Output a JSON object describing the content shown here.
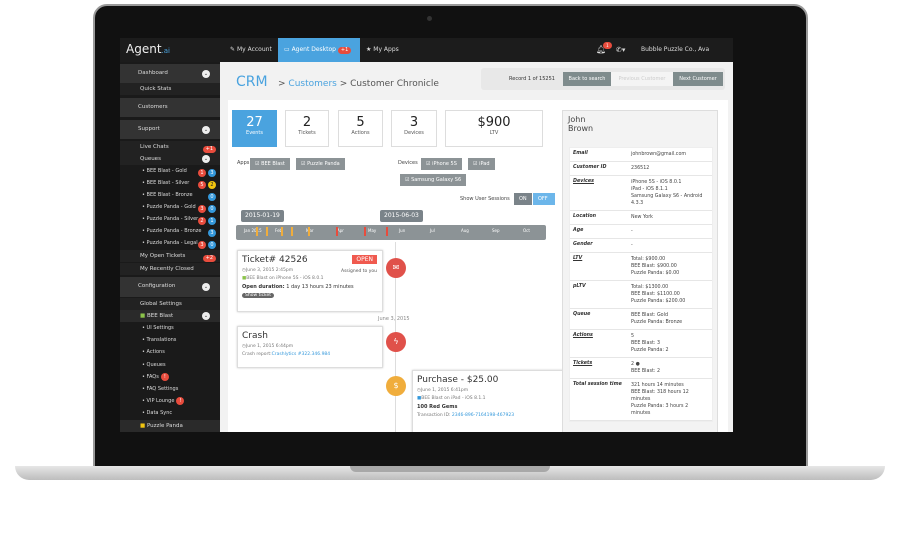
{
  "topbar": {
    "logo": "Agent",
    "logo_suffix": ".ai",
    "nav": [
      {
        "label": "My Account",
        "icon": "edit-icon"
      },
      {
        "label": "Agent Desktop",
        "icon": "monitor-icon",
        "badge": "+1"
      },
      {
        "label": "My Apps",
        "icon": "star-icon"
      }
    ],
    "notification_count": "1",
    "account": "Bubble Puzzle Co., Ava Smith"
  },
  "sidebar": {
    "items": [
      {
        "label": "Dashboard",
        "type": "section",
        "icon": "dashboard-icon"
      },
      {
        "label": "Quick Stats",
        "type": "sub"
      },
      {
        "label": "Customers",
        "type": "section",
        "icon": "users-icon"
      },
      {
        "label": "Support",
        "type": "section",
        "icon": "document-icon"
      },
      {
        "label": "Live Chats",
        "type": "sub",
        "badge": "+1"
      },
      {
        "label": "Queues",
        "type": "sub"
      }
    ],
    "queues": [
      {
        "label": "BEE Blast - Gold",
        "red": "1",
        "blue": "3"
      },
      {
        "label": "BEE Blast - Silver",
        "red": "5",
        "yellow": "2"
      },
      {
        "label": "BEE Blast - Bronze",
        "blue": "0"
      },
      {
        "label": "Puzzle Panda - Gold",
        "red": "3",
        "blue": "0"
      },
      {
        "label": "Puzzle Panda - Silver",
        "red": "2",
        "blue": "1"
      },
      {
        "label": "Puzzle Panda - Bronze",
        "blue": "3"
      },
      {
        "label": "Puzzle Panda - Legal",
        "red": "3",
        "blue": "0"
      }
    ],
    "my_open_tickets": "My Open Tickets",
    "my_open_badge": "+2",
    "recently_closed": "My Recently Closed",
    "configuration": "Configuration",
    "global_settings": "Global Settings",
    "bee_blast": "BEE Blast",
    "bee_sub": [
      "UI Settings",
      "Translations",
      "Actions",
      "Queues",
      "FAQs",
      "FAQ Settings",
      "VIP Lounge",
      "Data Sync"
    ],
    "bee_sub_alert": "!",
    "puzzle_panda": "Puzzle Panda"
  },
  "main": {
    "crm": "CRM",
    "breadcrumb_sep": ">",
    "breadcrumb_customers": "Customers",
    "breadcrumb_current": "Customer Chronicle",
    "record": "Record 1 of 15251",
    "back": "Back to search",
    "prev": "Previous Customer",
    "next": "Next Customer",
    "stats": [
      {
        "value": "27",
        "label": "Events"
      },
      {
        "value": "2",
        "label": "Tickets"
      },
      {
        "value": "5",
        "label": "Actions"
      },
      {
        "value": "3",
        "label": "Devices"
      },
      {
        "value": "$900",
        "label": "LTV"
      }
    ],
    "apps_label": "Apps",
    "apps": [
      "☑ BEE Blast",
      "☑ Puzzle Panda"
    ],
    "devices_label": "Devices",
    "devices": [
      "☑ iPhone 5S",
      "☑ iPad",
      "☑ Samsung Galaxy S6"
    ],
    "sessions_label": "Show User Sessions",
    "on": "ON",
    "off": "OFF",
    "timeline": {
      "start": "2015-01-19",
      "end": "2015-06-03",
      "months": [
        "Jan 2015",
        "Feb",
        "Mar",
        "Apr",
        "May",
        "Jun",
        "Jul",
        "Aug",
        "Sep",
        "Oct"
      ]
    },
    "ticket": {
      "title": "Ticket# 42526",
      "status": "OPEN",
      "date": "June 3, 2015 2:45pm",
      "assigned": "Assigned to you",
      "device": "BEE Blast on  iPhone 5S - iOS 8.0.1",
      "duration_label": "Open duration:",
      "duration": "1 day 13 hours 23 minutes",
      "show": "Show ticket"
    },
    "date_sep": "June 3, 2015",
    "crash": {
      "title": "Crash",
      "date": "June 1, 2015 6:44pm",
      "report_label": "Crash report:",
      "report": "Crashlytics #322.346.984"
    },
    "purchase": {
      "title": "Purchase - $25.00",
      "date": "June 1, 2015 6:41pm",
      "device": "BEE Blast on  iPad - iOS 8.1.1",
      "item": "100 Red Gems",
      "tx_label": "Transaction ID:",
      "tx": "2346-896-7164198-467923"
    }
  },
  "profile": {
    "first": "John",
    "last": "Brown",
    "rows": [
      {
        "k": "Email",
        "v": [
          "johnbrown@gmail.com"
        ]
      },
      {
        "k": "Customer ID",
        "v": [
          "236512"
        ]
      },
      {
        "k": "Devices",
        "u": true,
        "v": [
          " iPhone 5S - iOS 8.0.1",
          " iPad - iOS 8.1.1",
          " Samsung Galaxy S6 - Android 4.3.3"
        ]
      },
      {
        "k": "Location",
        "v": [
          "New York"
        ]
      },
      {
        "k": "Age",
        "v": [
          "-"
        ]
      },
      {
        "k": "Gender",
        "v": [
          "-"
        ]
      },
      {
        "k": "LTV",
        "u": true,
        "v": [
          "Total: $900.00",
          "BEE Blast: $900.00",
          "Puzzle Panda: $0.00"
        ]
      },
      {
        "k": "pLTV",
        "v": [
          "Total: $1300.00",
          "BEE Blast: $1100.00",
          "Puzzle Panda: $200.00"
        ]
      },
      {
        "k": "Queue",
        "v": [
          "BEE Blast: Gold",
          "Puzzle Panda: Bronze"
        ]
      },
      {
        "k": "Actions",
        "u": true,
        "v": [
          "5",
          "BEE Blast: 3",
          "Puzzle Panda: 2"
        ]
      },
      {
        "k": "Tickets",
        "u": true,
        "v": [
          "2 ●",
          "BEE Blast: 2"
        ]
      },
      {
        "k": "Total session time",
        "v": [
          "321 hours 14 minutes",
          "BEE Blast: 318 hours 12 minutes",
          "Puzzle Panda: 3 hours 2 minutes"
        ]
      }
    ]
  },
  "colors": {
    "accent": "#4aa3df",
    "danger": "#e84c3d",
    "purchase": "#f0ad3c"
  }
}
